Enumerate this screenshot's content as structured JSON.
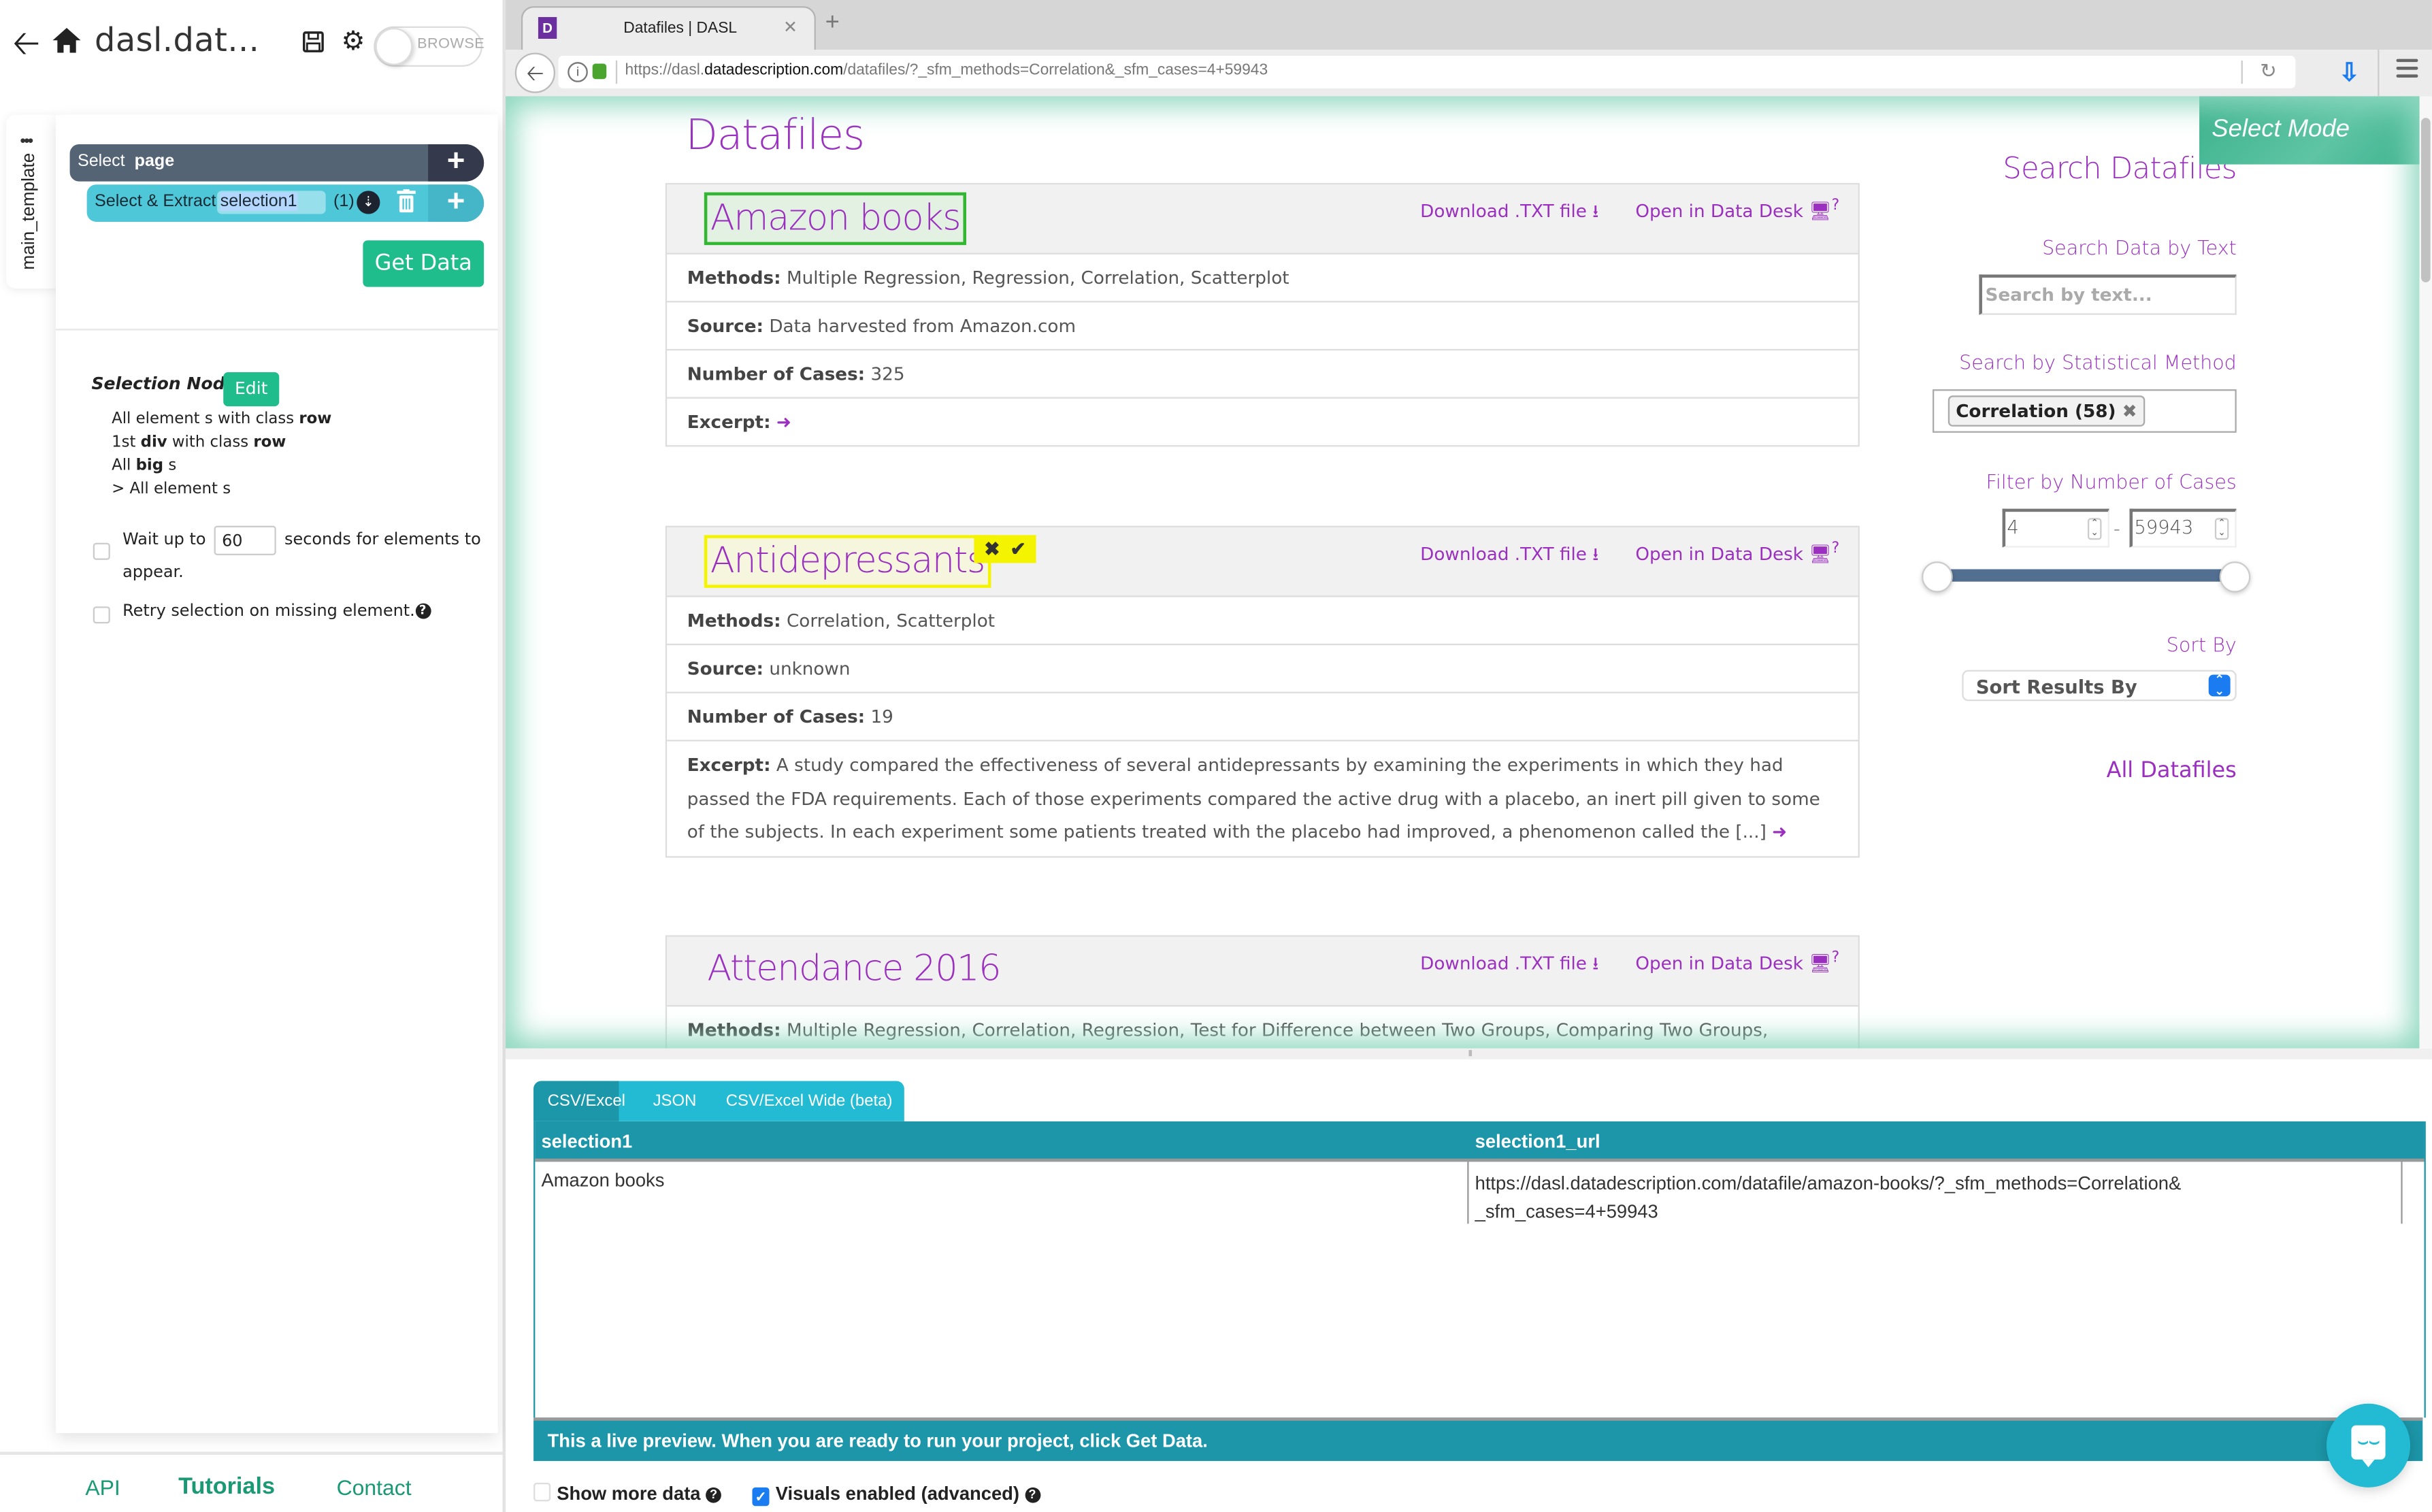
{
  "app": {
    "title": "dasl.dat...",
    "toggle_label": "BROWSE",
    "template_name": "main_template",
    "template_menu": "•••",
    "commands": {
      "select_prefix": "Select",
      "select_target": "page",
      "extract_label": "Select & Extract",
      "extract_name": "selection1",
      "extract_count": "(1)"
    },
    "get_data_label": "Get Data",
    "selection_node_label": "Selection Node:",
    "edit_label": "Edit",
    "node_lines": [
      {
        "pre": "All element s with class ",
        "bold": "row",
        "post": ""
      },
      {
        "pre": "1st ",
        "bold": "div",
        "post": " with class ",
        "bold2": "row"
      },
      {
        "pre": "All ",
        "bold": "big",
        "post": " s"
      },
      {
        "pre": "> All element s",
        "bold": "",
        "post": ""
      }
    ],
    "wait_prefix": "Wait up to",
    "wait_value": "60",
    "wait_suffix": "seconds for elements to appear.",
    "retry_label": "Retry selection on missing element.",
    "footer": {
      "api": "API",
      "tutorials": "Tutorials",
      "contact": "Contact"
    }
  },
  "browser": {
    "tab_title": "Datafiles | DASL",
    "favicon": "D",
    "url_prefix": "https://dasl.",
    "url_domain": "datadescription.com",
    "url_path": "/datafiles/?_sfm_methods=Correlation&_sfm_cases=4+59943",
    "select_mode_label": "Select Mode"
  },
  "page": {
    "heading": "Datafiles",
    "download_label": "Download .TXT file",
    "open_label": "Open in Data Desk",
    "labels": {
      "methods": "Methods:",
      "source": "Source:",
      "cases": "Number of Cases:",
      "excerpt": "Excerpt:"
    },
    "datafiles": [
      {
        "name": "Amazon books",
        "methods": "Multiple Regression, Regression, Correlation, Scatterplot",
        "source": "Data harvested from Amazon.com",
        "cases": "325",
        "excerpt": ""
      },
      {
        "name": "Antidepressants",
        "methods": "Correlation, Scatterplot",
        "source": "unknown",
        "cases": "19",
        "excerpt": "A study compared the effectiveness of several antidepressants by examining the experiments in which they had passed the FDA requirements. Each of those experiments compared the active drug with a placebo, an inert pill given to some of the subjects. In each experiment some patients treated with the placebo had improved, a phenomenon called the [...]"
      },
      {
        "name": "Attendance 2016",
        "methods": "Multiple Regression, Correlation, Regression, Test for Difference between Two Groups, Comparing Two Groups,"
      }
    ],
    "sidebar": {
      "title": "Search Datafiles",
      "text_label": "Search Data by Text",
      "text_placeholder": "Search by text...",
      "method_label": "Search by Statistical Method",
      "method_chip": "Correlation  (58)",
      "cases_label": "Filter by Number of Cases",
      "cases_min": "4",
      "cases_max": "59943",
      "range_min_fraction": 0,
      "range_max_fraction": 1,
      "sort_label": "Sort By",
      "sort_value": "Sort Results By",
      "all_link": "All Datafiles"
    }
  },
  "preview": {
    "tabs": [
      "CSV/Excel",
      "JSON",
      "CSV/Excel Wide (beta)"
    ],
    "active_tab": "CSV/Excel",
    "columns": [
      "selection1",
      "selection1_url"
    ],
    "rows": [
      [
        "Amazon books",
        "https://dasl.datadescription.com/datafile/amazon-books/?_sfm_methods=Correlation& _sfm_cases=4+59943"
      ]
    ],
    "footer_note": "This a live preview. When you are ready to run your project, click Get Data.",
    "show_more_label": "Show more data",
    "show_more_checked": false,
    "visuals_label": "Visuals enabled (advanced)",
    "visuals_checked": true
  },
  "colors": {
    "brand_green": "#1fbc8c",
    "purple": "#9b30c0",
    "teal": "#1c96a8",
    "cyan": "#22bbd3"
  }
}
